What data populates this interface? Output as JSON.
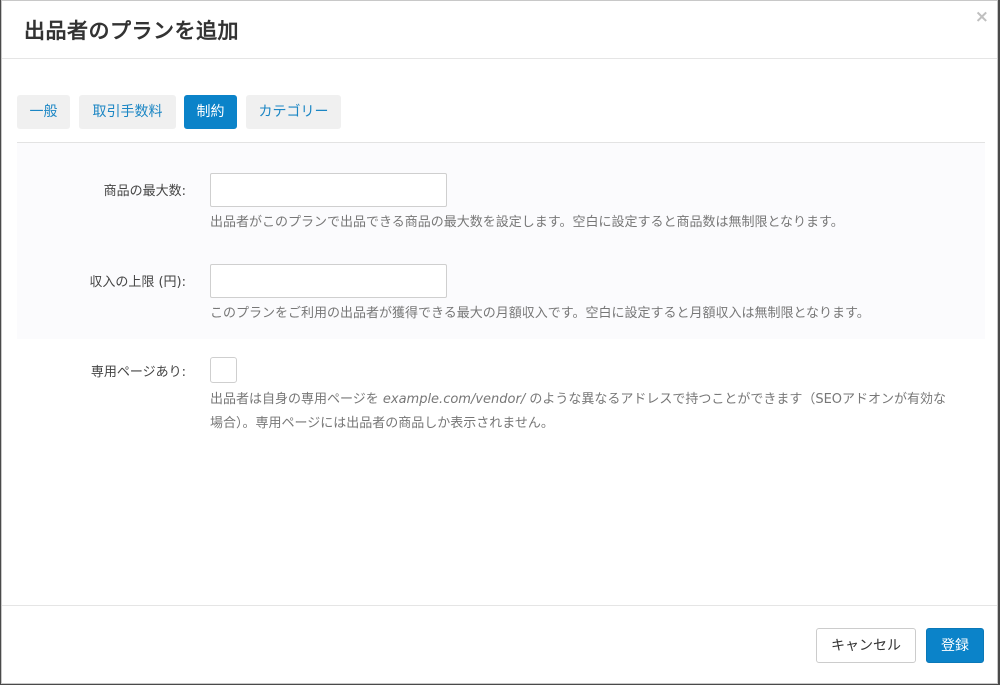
{
  "modal": {
    "title": "出品者のプランを追加",
    "close_symbol": "×"
  },
  "tabs": [
    {
      "label": "一般",
      "active": false
    },
    {
      "label": "取引手数料",
      "active": false
    },
    {
      "label": "制約",
      "active": true
    },
    {
      "label": "カテゴリー",
      "active": false
    }
  ],
  "fields": {
    "max_products": {
      "label": "商品の最大数:",
      "value": "",
      "help": "出品者がこのプランで出品できる商品の最大数を設定します。空白に設定すると商品数は無制限となります。"
    },
    "income_limit": {
      "label": "収入の上限 (円):",
      "value": "",
      "help": "このプランをご利用の出品者が獲得できる最大の月額収入です。空白に設定すると月額収入は無制限となります。"
    },
    "vendor_page": {
      "label": "専用ページあり:",
      "checked": false,
      "help_prefix": "出品者は自身の専用ページを ",
      "help_example": "example.com/vendor/",
      "help_suffix": " のような異なるアドレスで持つことができます（SEOアドオンが有効な",
      "help_line2": "場合）。専用ページには出品者の商品しか表示されません。"
    }
  },
  "footer": {
    "cancel_label": "キャンセル",
    "submit_label": "登録"
  },
  "colors": {
    "primary": "#0b83c9",
    "link": "#1b86c4"
  }
}
